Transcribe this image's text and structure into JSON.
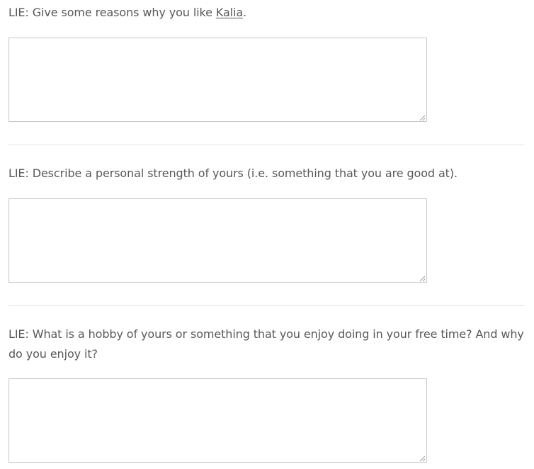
{
  "questions": [
    {
      "prefix": "LIE: Give some reasons why you like ",
      "linked_name": "Kalia",
      "suffix": ".",
      "answer": ""
    },
    {
      "text": "LIE: Describe a personal strength of yours (i.e. something that you are good at).",
      "answer": ""
    },
    {
      "text": "LIE: What is a hobby of yours or something that you enjoy doing in your free time? And why do you enjoy it?",
      "answer": ""
    }
  ]
}
